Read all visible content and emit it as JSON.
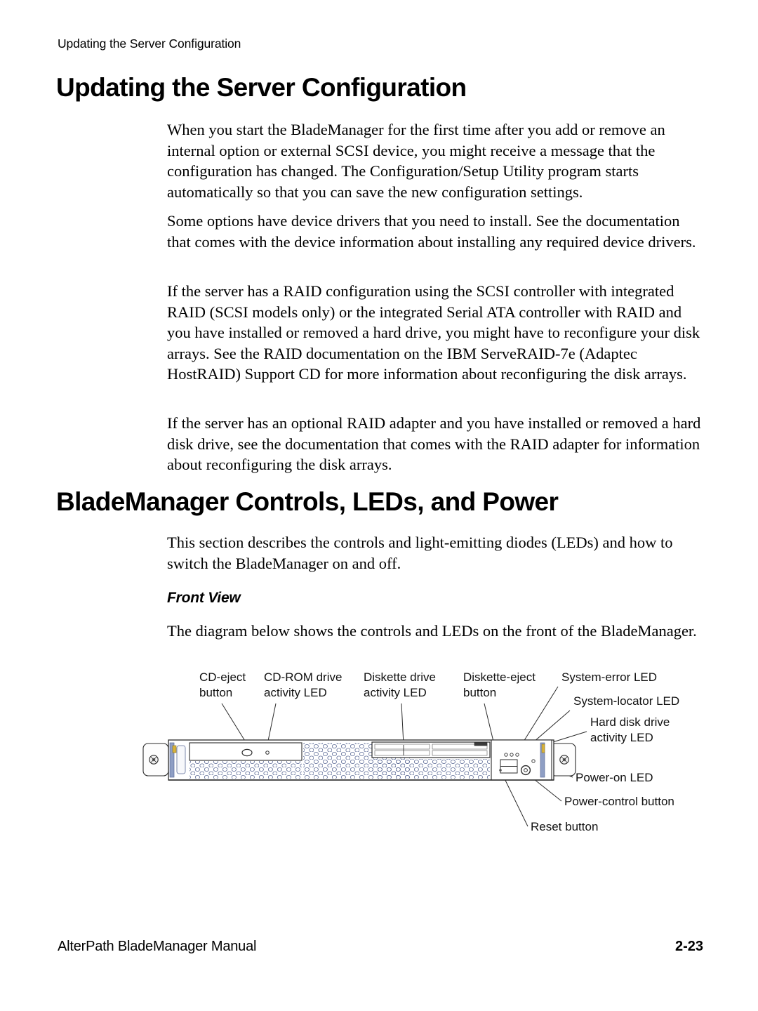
{
  "header": {
    "running_header": "Updating the Server Configuration"
  },
  "sections": {
    "heading_updating": "Updating the Server Configuration",
    "heading_controls": "BladeManager Controls, LEDs, and Power",
    "subheading_front_view": "Front View"
  },
  "paragraphs": {
    "p1": "When you start the BladeManager for the first time after you add or remove an internal option or external SCSI device, you might receive a message that the configuration has changed. The Configuration/Setup Utility program starts automatically so that you can save the new configuration settings.",
    "p2": "Some options have device drivers that you need to install. See the documentation that comes with the device information about installing any required device drivers.",
    "p3": "If the server has a RAID configuration using the SCSI controller with integrated RAID (SCSI models only) or the integrated Serial ATA controller with RAID and you have installed or removed a hard drive, you might have to reconfigure your disk arrays. See the RAID documentation on the IBM ServeRAID-7e (Adaptec HostRAID) Support CD for more information about reconfiguring the disk arrays.",
    "p4": "If the server has an optional RAID adapter and you have installed or removed a hard disk drive, see the documentation that comes with the RAID adapter for information about reconfiguring the disk arrays.",
    "p5": "This section describes the controls and light-emitting diodes (LEDs) and how to switch the BladeManager on and off.",
    "p6": "The diagram below shows the controls and LEDs on the front of the BladeManager."
  },
  "figure": {
    "callouts": {
      "cd_eject_button_l1": "CD-eject",
      "cd_eject_button_l2": "button",
      "cdrom_activity_led_l1": "CD-ROM drive",
      "cdrom_activity_led_l2": "activity LED",
      "diskette_activity_led_l1": "Diskette drive",
      "diskette_activity_led_l2": "activity LED",
      "diskette_eject_button_l1": "Diskette-eject",
      "diskette_eject_button_l2": "button",
      "system_error_led": "System-error LED",
      "system_locator_led": "System-locator LED",
      "hard_disk_activity_led_l1": "Hard disk drive",
      "hard_disk_activity_led_l2": "activity LED",
      "power_on_led": "Power-on LED",
      "power_control_button": "Power-control button",
      "reset_button": "Reset button"
    }
  },
  "footer": {
    "manual_title": "AlterPath BladeManager Manual",
    "page_number": "2-23"
  },
  "colors": {
    "text": "#000000",
    "line": "#2b2b2b",
    "panel_accent": "#8e9ec4"
  }
}
